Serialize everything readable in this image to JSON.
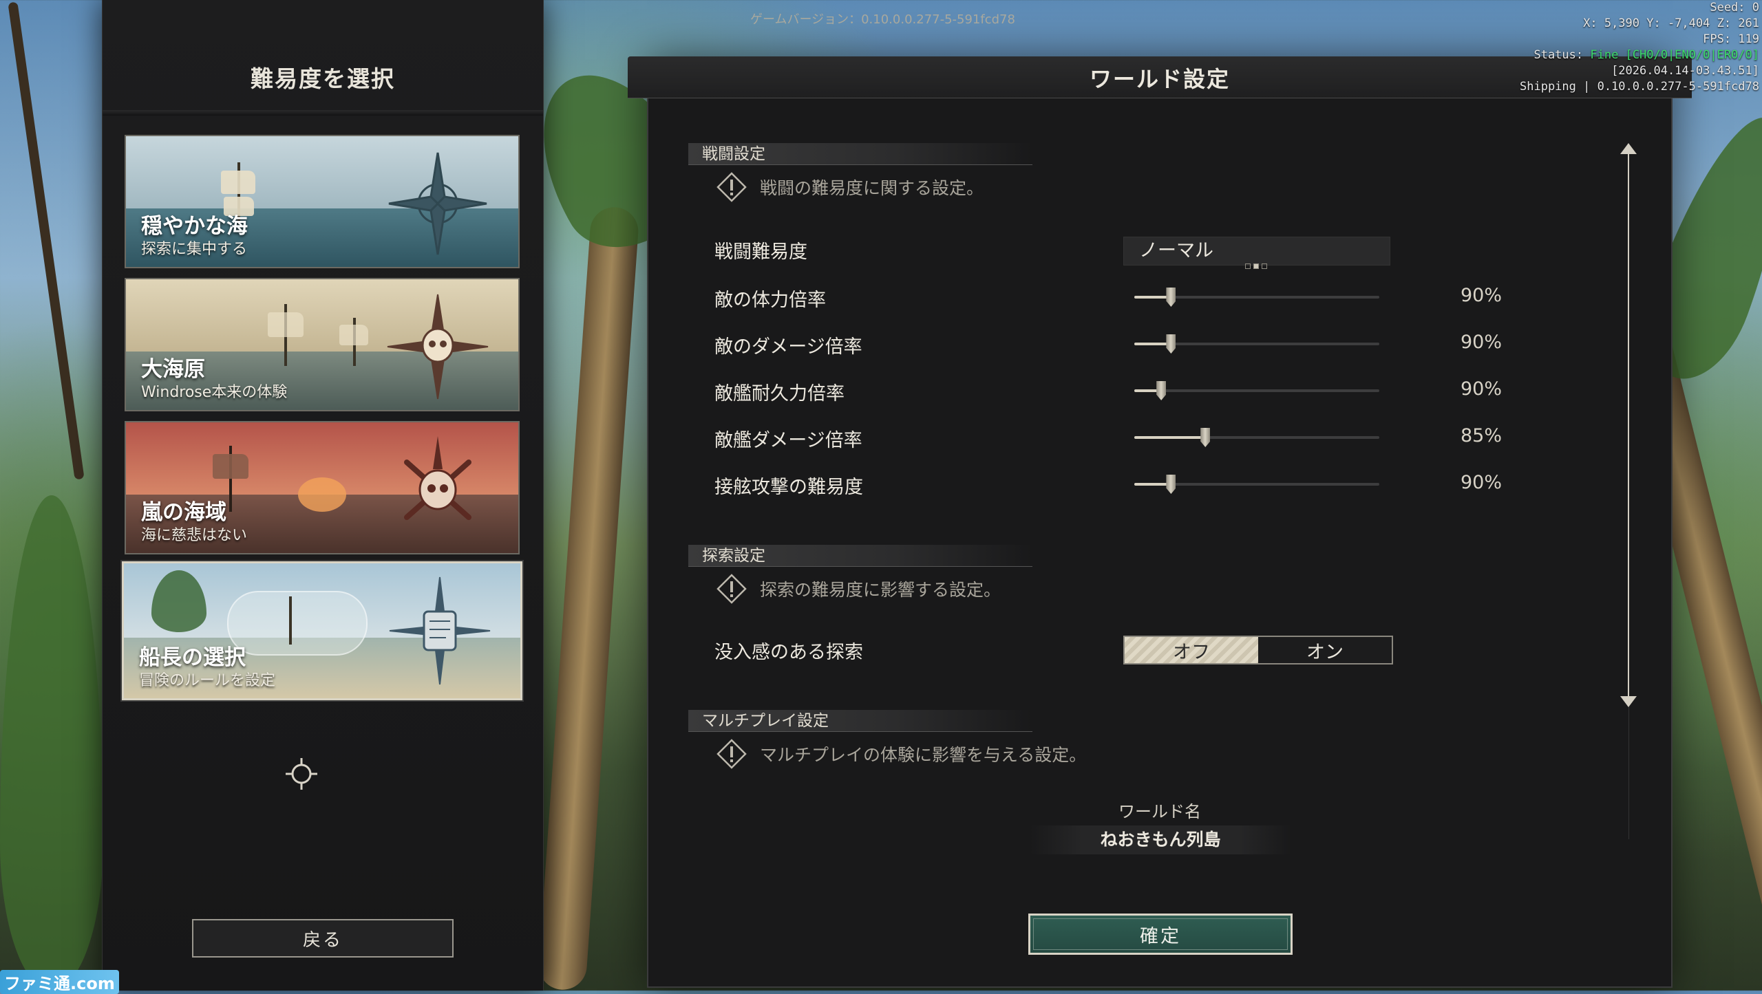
{
  "difficulty_panel": {
    "title": "難易度を選択",
    "cards": [
      {
        "title": "穏やかな海",
        "subtitle": "探索に集中する",
        "icon": "compass-rose-icon",
        "sky": "#b8ccd4",
        "sea": "#3e6a78"
      },
      {
        "title": "大海原",
        "subtitle": "Windrose本来の体験",
        "icon": "skull-compass-icon",
        "sky": "#d2c5a6",
        "sea": "#5c6b66"
      },
      {
        "title": "嵐の海域",
        "subtitle": "海に慈悲はない",
        "icon": "skull-crossbones-icon",
        "sky": "#c47460",
        "sea": "#6b4a40"
      },
      {
        "title": "船長の選択",
        "subtitle": "冒険のルールを設定",
        "icon": "scroll-quill-icon",
        "sky": "#b6cddb",
        "sea": "#6f8f8f",
        "selected": true
      }
    ],
    "back_label": "戻る"
  },
  "world_settings": {
    "title": "ワールド設定",
    "version": "ゲームバージョン：0.10.0.0.277-5-591fcd78",
    "combat": {
      "heading": "戦闘設定",
      "description": "戦闘の難易度に関する設定。",
      "difficulty_label": "戦闘難易度",
      "difficulty_value": "ノーマル",
      "difficulty_level": 2,
      "difficulty_steps": 3,
      "sliders": [
        {
          "label": "敵の体力倍率",
          "value": "90%",
          "fraction": 0.15
        },
        {
          "label": "敵のダメージ倍率",
          "value": "90%",
          "fraction": 0.15
        },
        {
          "label": "敵艦耐久力倍率",
          "value": "90%",
          "fraction": 0.11
        },
        {
          "label": "敵艦ダメージ倍率",
          "value": "85%",
          "fraction": 0.29
        },
        {
          "label": "接舷攻撃の難易度",
          "value": "90%",
          "fraction": 0.15
        }
      ]
    },
    "exploration": {
      "heading": "探索設定",
      "description": "探索の難易度に影響する設定。",
      "immersive_label": "没入感のある探索",
      "toggle_off": "オフ",
      "toggle_on": "オン",
      "selected": "オフ"
    },
    "multiplayer": {
      "heading": "マルチプレイ設定",
      "description": "マルチプレイの体験に影響を与える設定。"
    },
    "world_name_label": "ワールド名",
    "world_name": "ねおきもん列島",
    "confirm_label": "確定"
  },
  "debug": {
    "seed": "Seed: 0",
    "coords": "X: 5,390  Y: -7,404  Z: 261",
    "fps": "FPS: 119",
    "status_prefix": "Status: ",
    "status_fine": "Fine [CH0/0|EN0/0|ER0/0]",
    "timestamp": "[2026.04.14-03.43.51]",
    "build": "Shipping | 0.10.0.0.277-5-591fcd78"
  },
  "watermark": "ファミ通.com",
  "colors": {
    "accent_confirm": "#2f5d52",
    "panel_bg": "#19191a",
    "debug_green": "#3ddc6a"
  }
}
